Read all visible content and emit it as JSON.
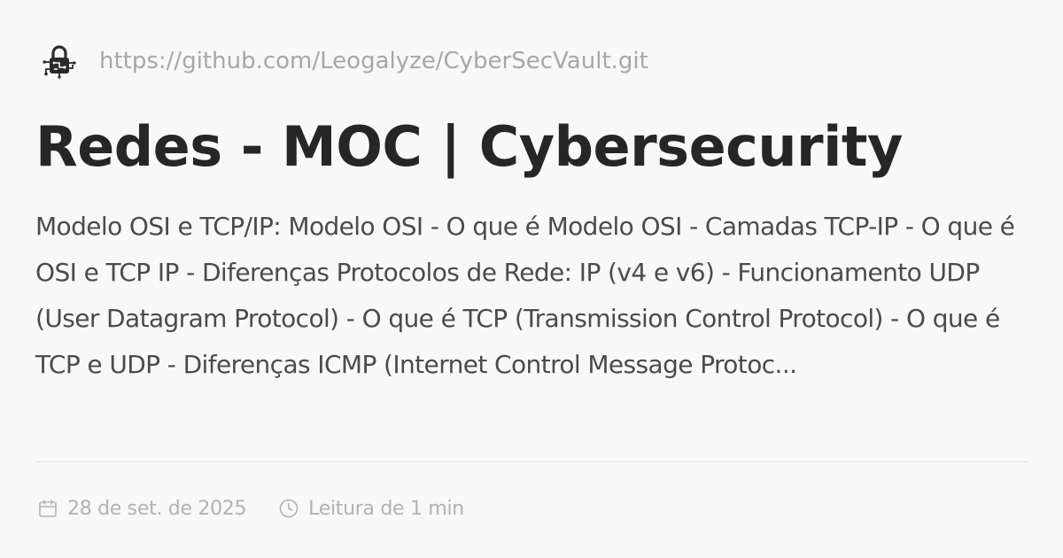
{
  "source": {
    "url": "https://github.com/Leogalyze/CyberSecVault.git",
    "logo_icon": "lock-circuit-icon"
  },
  "article": {
    "title": "Redes - MOC | Cybersecurity",
    "description": "Modelo OSI e TCP/IP: Modelo OSI - O que é Modelo OSI - Camadas TCP-IP - O que é OSI e TCP IP - Diferenças Protocolos de Rede: IP (v4 e v6) - Funcionamento UDP (User Datagram Protocol) - O que é TCP (Transmission Control Protocol) - O que é TCP e UDP - Diferenças ICMP (Internet Control Message Protoc..."
  },
  "meta": {
    "date": "28 de set. de 2025",
    "date_icon": "calendar-icon",
    "reading_time": "Leitura de 1 min",
    "reading_time_icon": "clock-icon"
  },
  "colors": {
    "background": "#f8f8f9",
    "title": "#262626",
    "description": "#4b4b4d",
    "muted": "#a5a7ab",
    "divider": "#e4e4e6"
  }
}
